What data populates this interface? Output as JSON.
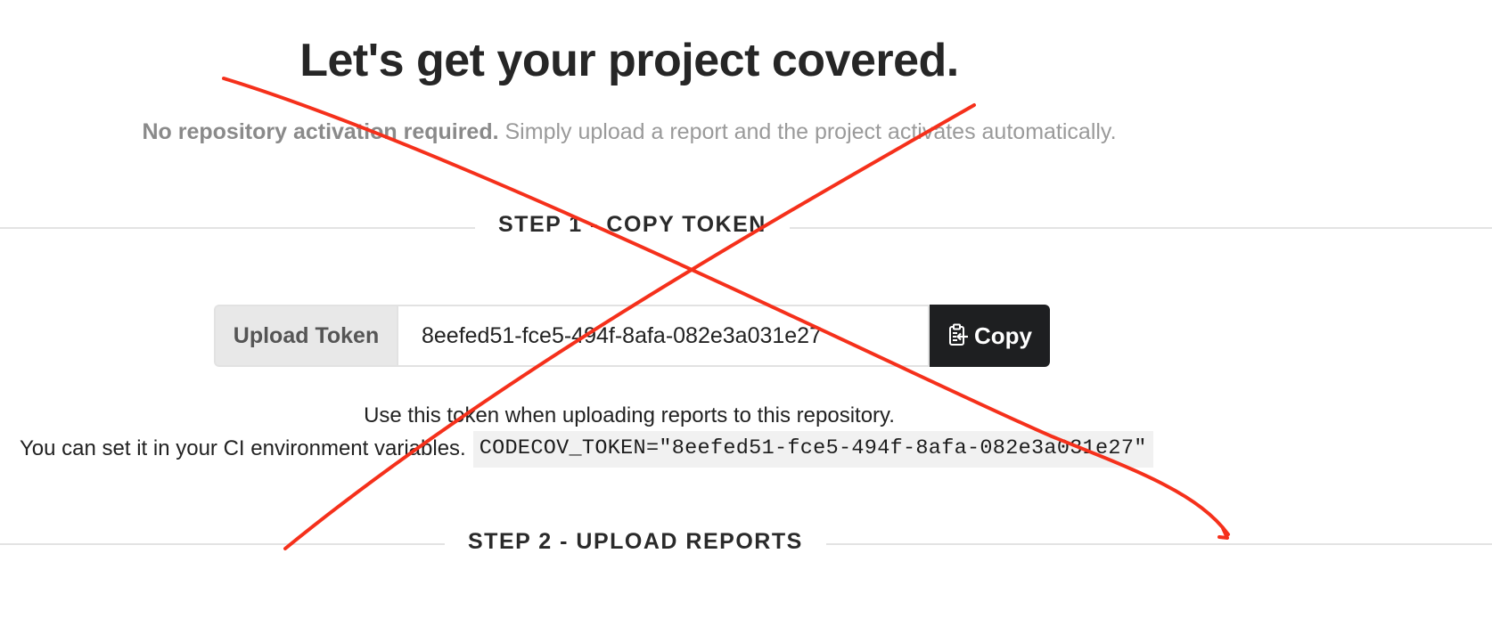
{
  "header": {
    "headline": "Let's get your project covered.",
    "subtitle_strong": "No repository activation required.",
    "subtitle_rest": " Simply upload a report and the project activates automatically."
  },
  "step1": {
    "title": "STEP 1 - COPY TOKEN",
    "token_label": "Upload Token",
    "token_value": "8eefed51-fce5-494f-8afa-082e3a031e27",
    "copy_label": "Copy",
    "copy_icon": "clipboard-copy-icon",
    "help_line1": "Use this token when uploading reports to this repository.",
    "help_line2": "You can set it in your CI environment variables.",
    "env_snippet": "CODECOV_TOKEN=\"8eefed51-fce5-494f-8afa-082e3a031e27\""
  },
  "step2": {
    "title": "STEP 2 - UPLOAD REPORTS"
  },
  "colors": {
    "annotation_red": "#f5301b",
    "copy_button_bg": "#1e1f21",
    "divider": "#e3e3e3"
  }
}
